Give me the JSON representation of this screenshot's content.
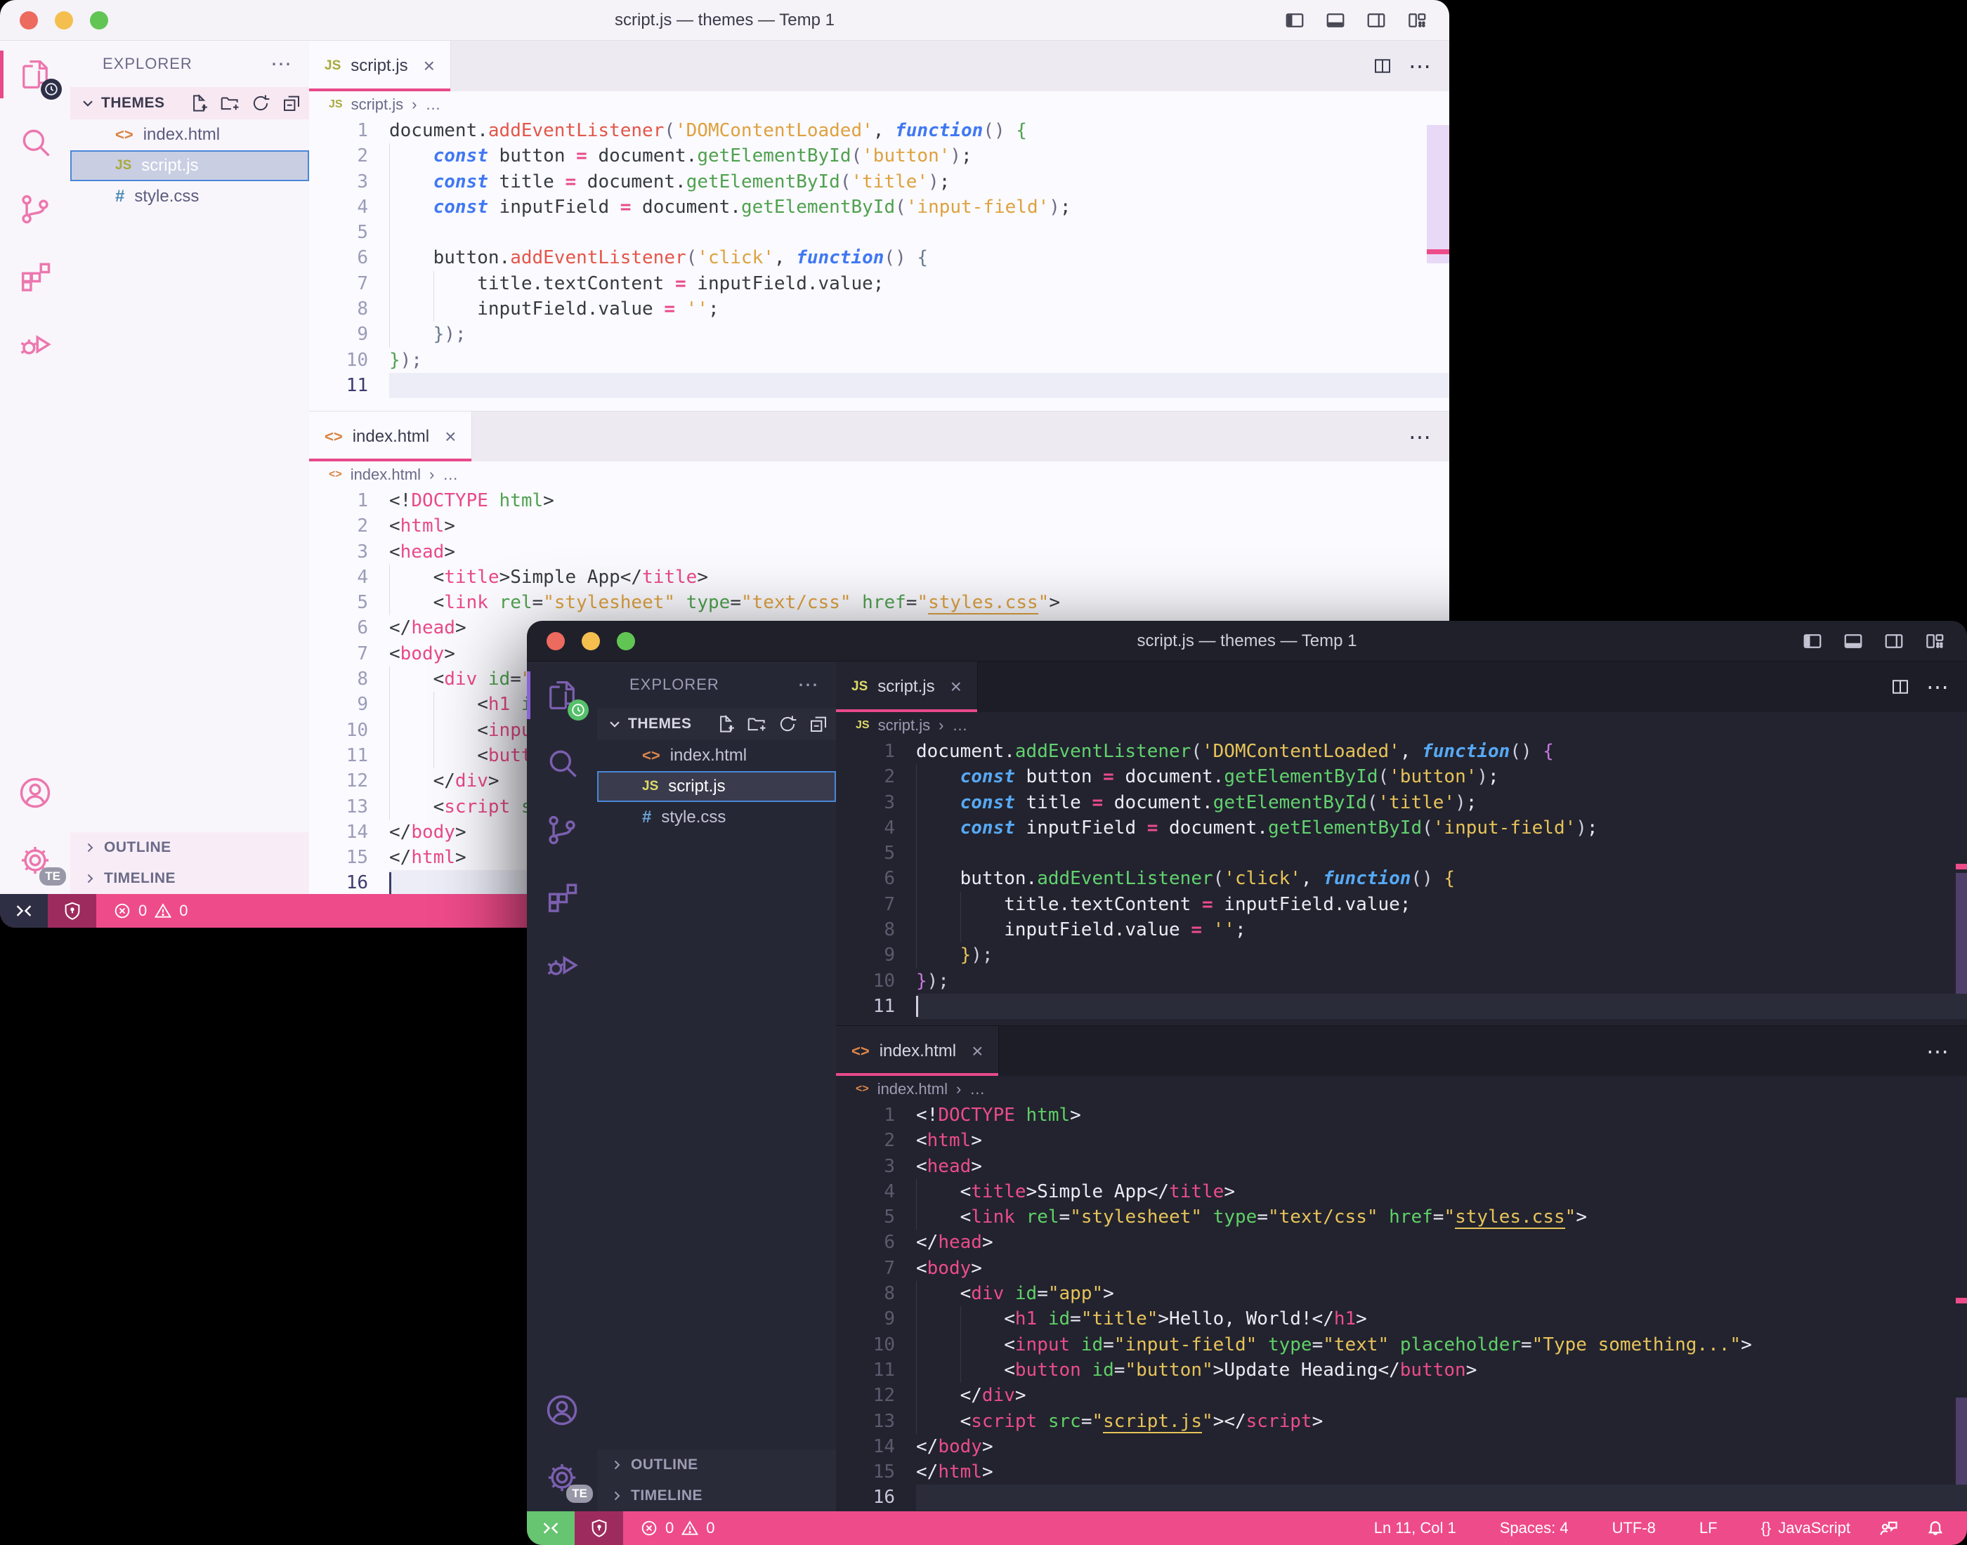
{
  "window": {
    "title": "script.js — themes — Temp 1"
  },
  "activity_bar": {
    "settings_badge": "TE"
  },
  "explorer": {
    "header": "EXPLORER",
    "folder": "THEMES",
    "files": [
      "index.html",
      "script.js",
      "style.css"
    ],
    "selected_file": "script.js",
    "outline": "OUTLINE",
    "timeline": "TIMELINE"
  },
  "tabs": {
    "js": "script.js",
    "html": "index.html"
  },
  "breadcrumb": {
    "more": "…"
  },
  "glyphs": {
    "dots": "⋯",
    "close": "×",
    "crumb_sep": "›",
    "js_icon": "JS",
    "html_icon": "<>",
    "css_icon": "#",
    "braces": "{}"
  },
  "status": {
    "errors": "0",
    "warnings": "0",
    "line_col": "Ln 11, Col 1",
    "spaces": "Spaces: 4",
    "encoding": "UTF-8",
    "eol": "LF",
    "language": "JavaScript"
  },
  "colors": {
    "accent_pink": "#e9498a",
    "status_pink": "#ee4b8a",
    "trust_maroon": "#9e2b5e",
    "remote_green": "#67c471",
    "remote_navy": "#2e2e44",
    "light_activity_icon": "#ec77ae",
    "dark_activity_icon": "#7b5fb0",
    "selection_border": "#4a86d8"
  },
  "code": {
    "js_active_line": 11,
    "html_active_line": 16,
    "js_lines": [
      {
        "g": 0,
        "t": [
          [
            "p",
            "document."
          ],
          [
            "m",
            "addEventListener"
          ],
          [
            "x",
            "("
          ],
          [
            "s",
            "'DOMContentLoaded'"
          ],
          [
            "p",
            ", "
          ],
          [
            "k",
            "function"
          ],
          [
            "x",
            "()"
          ],
          [
            "b1",
            " {"
          ]
        ]
      },
      {
        "g": 1,
        "t": [
          [
            "p",
            "    "
          ],
          [
            "k",
            "const"
          ],
          [
            "p",
            " button "
          ],
          [
            "o",
            "="
          ],
          [
            "p",
            " document."
          ],
          [
            "g",
            "getElementById"
          ],
          [
            "x",
            "("
          ],
          [
            "s",
            "'button'"
          ],
          [
            "x",
            ")"
          ],
          [
            "p",
            ";"
          ]
        ]
      },
      {
        "g": 1,
        "t": [
          [
            "p",
            "    "
          ],
          [
            "k",
            "const"
          ],
          [
            "p",
            " title "
          ],
          [
            "o",
            "="
          ],
          [
            "p",
            " document."
          ],
          [
            "g",
            "getElementById"
          ],
          [
            "x",
            "("
          ],
          [
            "s",
            "'title'"
          ],
          [
            "x",
            ")"
          ],
          [
            "p",
            ";"
          ]
        ]
      },
      {
        "g": 1,
        "t": [
          [
            "p",
            "    "
          ],
          [
            "k",
            "const"
          ],
          [
            "p",
            " inputField "
          ],
          [
            "o",
            "="
          ],
          [
            "p",
            " document."
          ],
          [
            "g",
            "getElementById"
          ],
          [
            "x",
            "("
          ],
          [
            "s",
            "'input-field'"
          ],
          [
            "x",
            ")"
          ],
          [
            "p",
            ";"
          ]
        ]
      },
      {
        "g": 1,
        "t": []
      },
      {
        "g": 1,
        "t": [
          [
            "p",
            "    button."
          ],
          [
            "m",
            "addEventListener"
          ],
          [
            "x",
            "("
          ],
          [
            "s",
            "'click'"
          ],
          [
            "p",
            ", "
          ],
          [
            "k",
            "function"
          ],
          [
            "x",
            "()"
          ],
          [
            "b2",
            " {"
          ]
        ]
      },
      {
        "g": 2,
        "t": [
          [
            "p",
            "        title.textContent "
          ],
          [
            "o",
            "="
          ],
          [
            "p",
            " inputField.value;"
          ]
        ]
      },
      {
        "g": 2,
        "t": [
          [
            "p",
            "        inputField.value "
          ],
          [
            "o",
            "="
          ],
          [
            "p",
            " "
          ],
          [
            "s",
            "''"
          ],
          [
            "p",
            ";"
          ]
        ]
      },
      {
        "g": 1,
        "t": [
          [
            "p",
            "    "
          ],
          [
            "b2",
            "}"
          ],
          [
            "x",
            ");"
          ]
        ]
      },
      {
        "g": 0,
        "t": [
          [
            "b1",
            "}"
          ],
          [
            "x",
            ");"
          ]
        ]
      },
      {
        "g": 0,
        "t": []
      }
    ],
    "html_lines": [
      {
        "g": 0,
        "t": [
          [
            "p",
            "<!"
          ],
          [
            "t",
            "DOCTYPE"
          ],
          [
            "p",
            " "
          ],
          [
            "a",
            "html"
          ],
          [
            "p",
            ">"
          ]
        ]
      },
      {
        "g": 0,
        "t": [
          [
            "p",
            "<"
          ],
          [
            "t",
            "html"
          ],
          [
            "p",
            ">"
          ]
        ]
      },
      {
        "g": 0,
        "t": [
          [
            "p",
            "<"
          ],
          [
            "t",
            "head"
          ],
          [
            "p",
            ">"
          ]
        ]
      },
      {
        "g": 1,
        "t": [
          [
            "p",
            "    <"
          ],
          [
            "t",
            "title"
          ],
          [
            "p",
            ">Simple App</"
          ],
          [
            "t",
            "title"
          ],
          [
            "p",
            ">"
          ]
        ]
      },
      {
        "g": 1,
        "t": [
          [
            "p",
            "    <"
          ],
          [
            "t",
            "link"
          ],
          [
            "p",
            " "
          ],
          [
            "a",
            "rel"
          ],
          [
            "p",
            "="
          ],
          [
            "s",
            "\"stylesheet\""
          ],
          [
            "p",
            " "
          ],
          [
            "a",
            "type"
          ],
          [
            "p",
            "="
          ],
          [
            "s",
            "\"text/css\""
          ],
          [
            "p",
            " "
          ],
          [
            "a",
            "href"
          ],
          [
            "p",
            "="
          ],
          [
            "s",
            "\""
          ],
          [
            "su",
            "styles.css"
          ],
          [
            "s",
            "\""
          ],
          [
            "p",
            ">"
          ]
        ]
      },
      {
        "g": 0,
        "t": [
          [
            "p",
            "</"
          ],
          [
            "t",
            "head"
          ],
          [
            "p",
            ">"
          ]
        ]
      },
      {
        "g": 0,
        "t": [
          [
            "p",
            "<"
          ],
          [
            "t",
            "body"
          ],
          [
            "p",
            ">"
          ]
        ]
      },
      {
        "g": 1,
        "t": [
          [
            "p",
            "    <"
          ],
          [
            "t",
            "div"
          ],
          [
            "p",
            " "
          ],
          [
            "a",
            "id"
          ],
          [
            "p",
            "="
          ],
          [
            "s",
            "\"app\""
          ],
          [
            "p",
            ">"
          ]
        ]
      },
      {
        "g": 2,
        "t": [
          [
            "p",
            "        <"
          ],
          [
            "t",
            "h1"
          ],
          [
            "p",
            " "
          ],
          [
            "a",
            "id"
          ],
          [
            "p",
            "="
          ],
          [
            "s",
            "\"title\""
          ],
          [
            "p",
            ">Hello, World!</"
          ],
          [
            "t",
            "h1"
          ],
          [
            "p",
            ">"
          ]
        ]
      },
      {
        "g": 2,
        "t": [
          [
            "p",
            "        <"
          ],
          [
            "t",
            "input"
          ],
          [
            "p",
            " "
          ],
          [
            "a",
            "id"
          ],
          [
            "p",
            "="
          ],
          [
            "s",
            "\"input-field\""
          ],
          [
            "p",
            " "
          ],
          [
            "a",
            "type"
          ],
          [
            "p",
            "="
          ],
          [
            "s",
            "\"text\""
          ],
          [
            "p",
            " "
          ],
          [
            "a",
            "placeholder"
          ],
          [
            "p",
            "="
          ],
          [
            "s",
            "\"Type something...\""
          ],
          [
            "p",
            ">"
          ]
        ]
      },
      {
        "g": 2,
        "t": [
          [
            "p",
            "        <"
          ],
          [
            "t",
            "button"
          ],
          [
            "p",
            " "
          ],
          [
            "a",
            "id"
          ],
          [
            "p",
            "="
          ],
          [
            "s",
            "\"button\""
          ],
          [
            "p",
            ">Update Heading</"
          ],
          [
            "t",
            "button"
          ],
          [
            "p",
            ">"
          ]
        ]
      },
      {
        "g": 1,
        "t": [
          [
            "p",
            "    </"
          ],
          [
            "t",
            "div"
          ],
          [
            "p",
            ">"
          ]
        ]
      },
      {
        "g": 1,
        "t": [
          [
            "p",
            "    <"
          ],
          [
            "t",
            "script"
          ],
          [
            "p",
            " "
          ],
          [
            "a",
            "src"
          ],
          [
            "p",
            "="
          ],
          [
            "s",
            "\""
          ],
          [
            "su",
            "script.js"
          ],
          [
            "s",
            "\""
          ],
          [
            "p",
            "></"
          ],
          [
            "t",
            "script"
          ],
          [
            "p",
            ">"
          ]
        ]
      },
      {
        "g": 0,
        "t": [
          [
            "p",
            "</"
          ],
          [
            "t",
            "body"
          ],
          [
            "p",
            ">"
          ]
        ]
      },
      {
        "g": 0,
        "t": [
          [
            "p",
            "</"
          ],
          [
            "t",
            "html"
          ],
          [
            "p",
            ">"
          ]
        ]
      },
      {
        "g": 0,
        "t": []
      }
    ]
  }
}
